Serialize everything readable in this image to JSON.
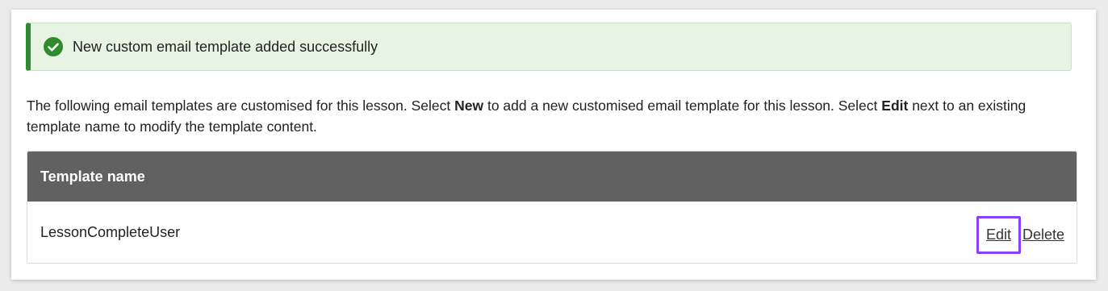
{
  "alert": {
    "message": "New custom email template added successfully",
    "icon": "check-circle-icon",
    "accent_color": "#2e8b2e"
  },
  "intro": {
    "text_1": "The following email templates are customised for this lesson. Select ",
    "bold_1": "New",
    "text_2": " to add a new customised email template for this lesson. Select ",
    "bold_2": "Edit",
    "text_3": " next to an existing template name to modify the template content."
  },
  "table": {
    "header": "Template name",
    "rows": [
      {
        "name": "LessonCompleteUser",
        "edit_label": "Edit",
        "delete_label": "Delete"
      }
    ]
  },
  "highlight_color": "#8a3ffc"
}
